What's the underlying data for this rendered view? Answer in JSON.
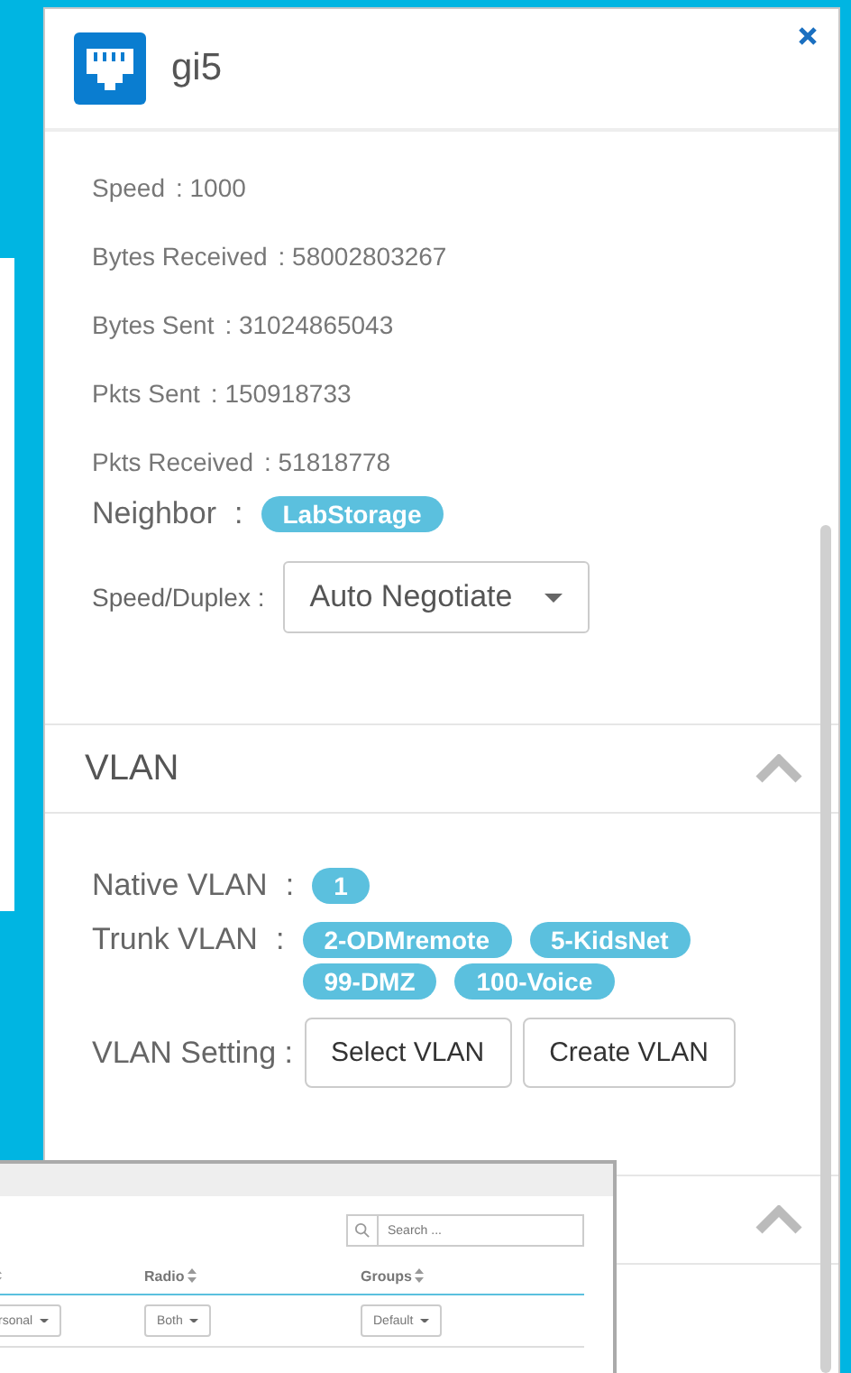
{
  "panel": {
    "title": "gi5",
    "stats": [
      {
        "label": "Speed",
        "value": ": 1000"
      },
      {
        "label": "Bytes Received",
        "value": ": 58002803267"
      },
      {
        "label": "Bytes Sent",
        "value": ": 31024865043"
      },
      {
        "label": "Pkts Sent",
        "value": ": 150918733"
      },
      {
        "label": "Pkts Received",
        "value": ": 51818778"
      }
    ],
    "neighbor": {
      "label": "Neighbor",
      "colon": ":",
      "tags": [
        "LabStorage"
      ]
    },
    "speed_duplex": {
      "label": "Speed/Duplex :",
      "value": "Auto Negotiate"
    },
    "vlan": {
      "title": "VLAN",
      "expanded": true,
      "native": {
        "label": "Native VLAN",
        "colon": ":",
        "tags": [
          "1"
        ]
      },
      "trunk": {
        "label": "Trunk VLAN",
        "colon": ":",
        "tags": [
          "2-ODMremote",
          "5-KidsNet",
          "99-DMZ",
          "100-Voice"
        ]
      },
      "setting": {
        "label": "VLAN Setting :",
        "buttons": [
          "Select VLAN",
          "Create VLAN"
        ]
      }
    },
    "next_section": {
      "expanded": true
    }
  },
  "back_window": {
    "search": {
      "placeholder": "Search ..."
    },
    "columns": [
      {
        "sortable": true
      },
      {
        "label": "Radio",
        "sortable": true
      },
      {
        "label": "Groups",
        "sortable": true
      }
    ],
    "row": [
      "rsonal",
      "Both",
      "Default"
    ]
  }
}
